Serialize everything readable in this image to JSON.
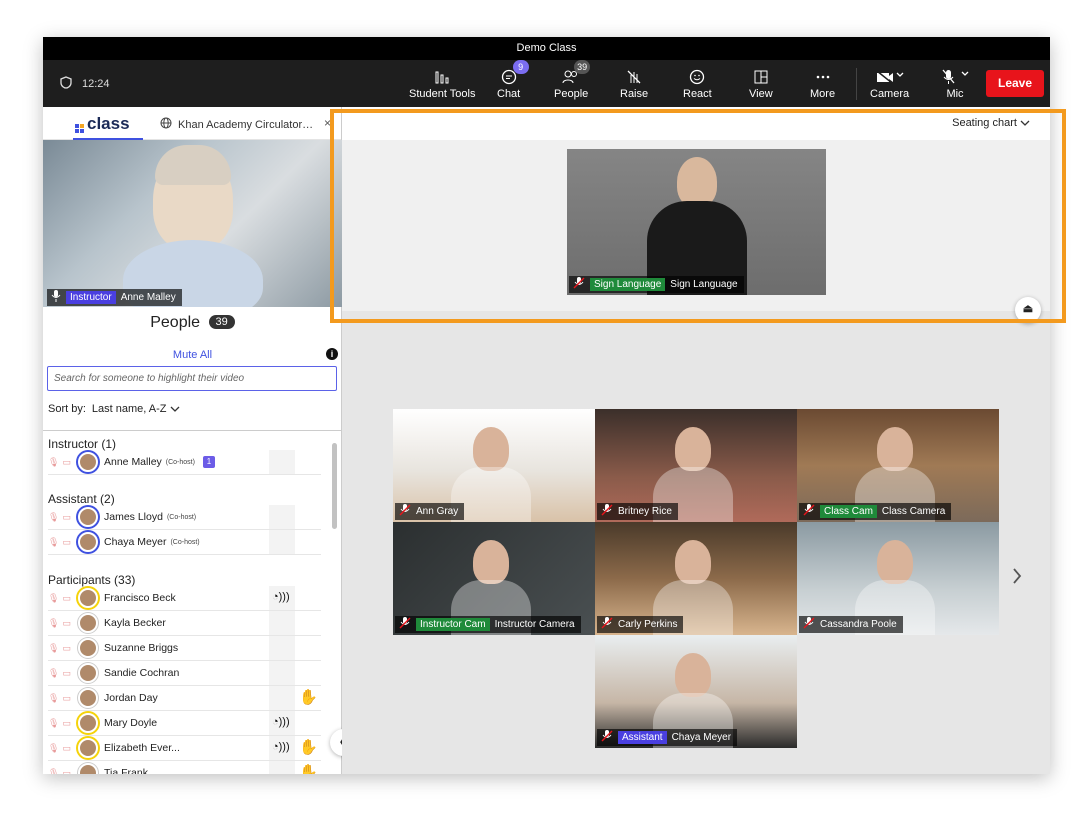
{
  "window": {
    "title": "Demo Class"
  },
  "toolbar": {
    "time": "12:24",
    "buttons": [
      {
        "label": "Student Tools",
        "icon": "bar-chart-icon"
      },
      {
        "label": "Chat",
        "icon": "chat-icon",
        "badge": "9"
      },
      {
        "label": "People",
        "icon": "people-icon",
        "badge": "39"
      },
      {
        "label": "Raise",
        "icon": "hand-off-icon"
      },
      {
        "label": "React",
        "icon": "smile-icon"
      },
      {
        "label": "View",
        "icon": "view-grid-icon"
      },
      {
        "label": "More",
        "icon": "more-icon"
      },
      {
        "label": "Camera",
        "icon": "camera-off-icon"
      },
      {
        "label": "Mic",
        "icon": "mic-off-icon"
      }
    ],
    "leave_label": "Leave"
  },
  "sidebar": {
    "tab_class": "class",
    "tab_khan": "Khan Academy Circulator…",
    "tab_close": "×",
    "instructor_video": {
      "tag": "Instructor",
      "name": "Anne Malley"
    },
    "people_title": "People",
    "people_count": "39",
    "mute_all": "Mute All",
    "search_placeholder": "Search for someone to highlight their video",
    "sort_label": "Sort by:",
    "sort_value": "Last name, A-Z",
    "sections": {
      "instructor": "Instructor (1)",
      "assistant": "Assistant  (2)",
      "participants": "Participants  (33)"
    },
    "cohost_label": "(Co-host)",
    "instructors": [
      {
        "name": "Anne Malley",
        "chat_badge": "1"
      }
    ],
    "assistants": [
      {
        "name": "James Lloyd"
      },
      {
        "name": "Chaya Meyer"
      }
    ],
    "participants": [
      {
        "name": "Francisco Beck",
        "talking": true,
        "hand": false,
        "ring": "yellow"
      },
      {
        "name": "Kayla Becker",
        "talking": false,
        "hand": false,
        "ring": "none"
      },
      {
        "name": "Suzanne Briggs",
        "talking": false,
        "hand": false,
        "ring": "none"
      },
      {
        "name": "Sandie Cochran",
        "talking": false,
        "hand": false,
        "ring": "none"
      },
      {
        "name": "Jordan Day",
        "talking": false,
        "hand": true,
        "ring": "none"
      },
      {
        "name": "Mary Doyle",
        "talking": true,
        "hand": false,
        "ring": "yellow"
      },
      {
        "name": "Elizabeth Ever...",
        "talking": true,
        "hand": true,
        "ring": "yellow"
      },
      {
        "name": "Tia Frank",
        "talking": false,
        "hand": true,
        "ring": "none"
      }
    ]
  },
  "stage": {
    "seating_label": "Seating chart",
    "sign_video": {
      "tag": "Sign Language",
      "name": "Sign Language"
    }
  },
  "grid": [
    {
      "name": "Ann Gray",
      "tag": ""
    },
    {
      "name": "Britney Rice",
      "tag": ""
    },
    {
      "name": "Class Camera",
      "tag": "Class Cam"
    },
    {
      "name": "Instructor Camera",
      "tag": "Instructor Cam"
    },
    {
      "name": "Carly Perkins",
      "tag": ""
    },
    {
      "name": "Cassandra Poole",
      "tag": ""
    },
    {
      "name": "Chaya Meyer",
      "tag": "Assistant"
    }
  ],
  "colors": {
    "accent": "#3f51e0",
    "leave": "#e8141b",
    "highlight": "#f39a1e",
    "tag_purple": "#4a3fe0",
    "tag_green": "#1f8a3a",
    "ring_yellow": "#f5d30b",
    "hand": "#f3b32a"
  }
}
